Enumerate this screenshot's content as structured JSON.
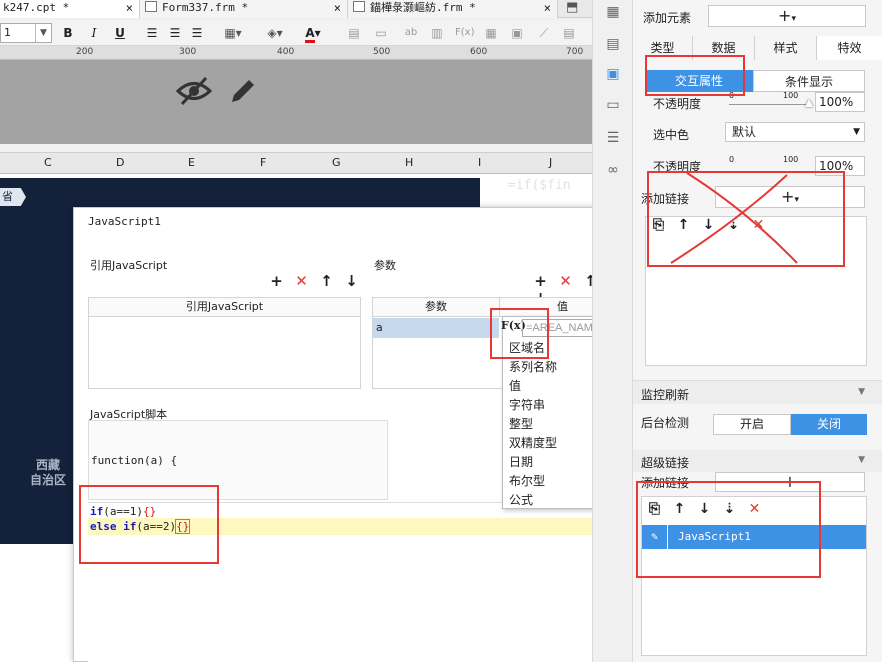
{
  "tabs": [
    {
      "label": "k247.cpt *",
      "close": "×"
    },
    {
      "label": "Form337.frm *",
      "close": "×"
    },
    {
      "label": "錨樺彔灏嶇紡.frm *",
      "close": "×"
    }
  ],
  "toolbar": {
    "font_size": "1",
    "bold": "B",
    "italic": "I",
    "underline": "U",
    "font_color": "A"
  },
  "ruler": {
    "marks": [
      "200",
      "300",
      "400",
      "500",
      "600",
      "700"
    ]
  },
  "columns": [
    "C",
    "D",
    "E",
    "F",
    "G",
    "H",
    "I",
    "J"
  ],
  "map": {
    "tag": "省",
    "region1": "西藏",
    "region2": "自治区",
    "formula_watermark": "=if($fin"
  },
  "dialog": {
    "title": "JavaScript1",
    "ref_section": "引用JavaScript",
    "ref_header": "引用JavaScript",
    "param_section": "参数",
    "param_col_name": "参数",
    "param_col_value": "值",
    "param_row_name": "a",
    "script_section": "JavaScript脚本",
    "function_line": "function(a) {",
    "code_if": "if",
    "code_if_rest": "(a==1)",
    "code_if_braces": "{}",
    "code_else": "else if",
    "code_else_rest": "(a==2)",
    "code_else_braces": "{}"
  },
  "dropdown": {
    "fx": "F(x)",
    "input_placeholder": "=AREA_NAME",
    "options": [
      "区域名",
      "系列名称",
      "值",
      "字符串",
      "整型",
      "双精度型",
      "日期",
      "布尔型",
      "公式"
    ]
  },
  "right": {
    "add_element": "添加元素",
    "add_symbol": "+",
    "tabs": [
      "类型",
      "数据",
      "样式",
      "特效"
    ],
    "subtabs": [
      "交互属性",
      "条件显示"
    ],
    "opacity_label": "不透明度",
    "opacity_value": "100%",
    "slider_min": "0",
    "slider_max": "100",
    "opacity_fraction": 1.0,
    "selected_color_label": "选中色",
    "selected_color_value": "默认",
    "opacity2_label": "不透明度",
    "opacity2_value": "100%",
    "add_link_label": "添加链接",
    "monitor_refresh": "监控刷新",
    "bg_check": "后台检测",
    "toggle_on": "开启",
    "toggle_off": "关闭",
    "hyperlink": "超级链接",
    "add_link2": "添加链接",
    "js_item": "JavaScript1"
  },
  "colors": {
    "accent": "#3e92e6",
    "red_annotation": "#e53935",
    "map_bg": "#13213a",
    "editor_highlight": "#fcf8c0"
  }
}
